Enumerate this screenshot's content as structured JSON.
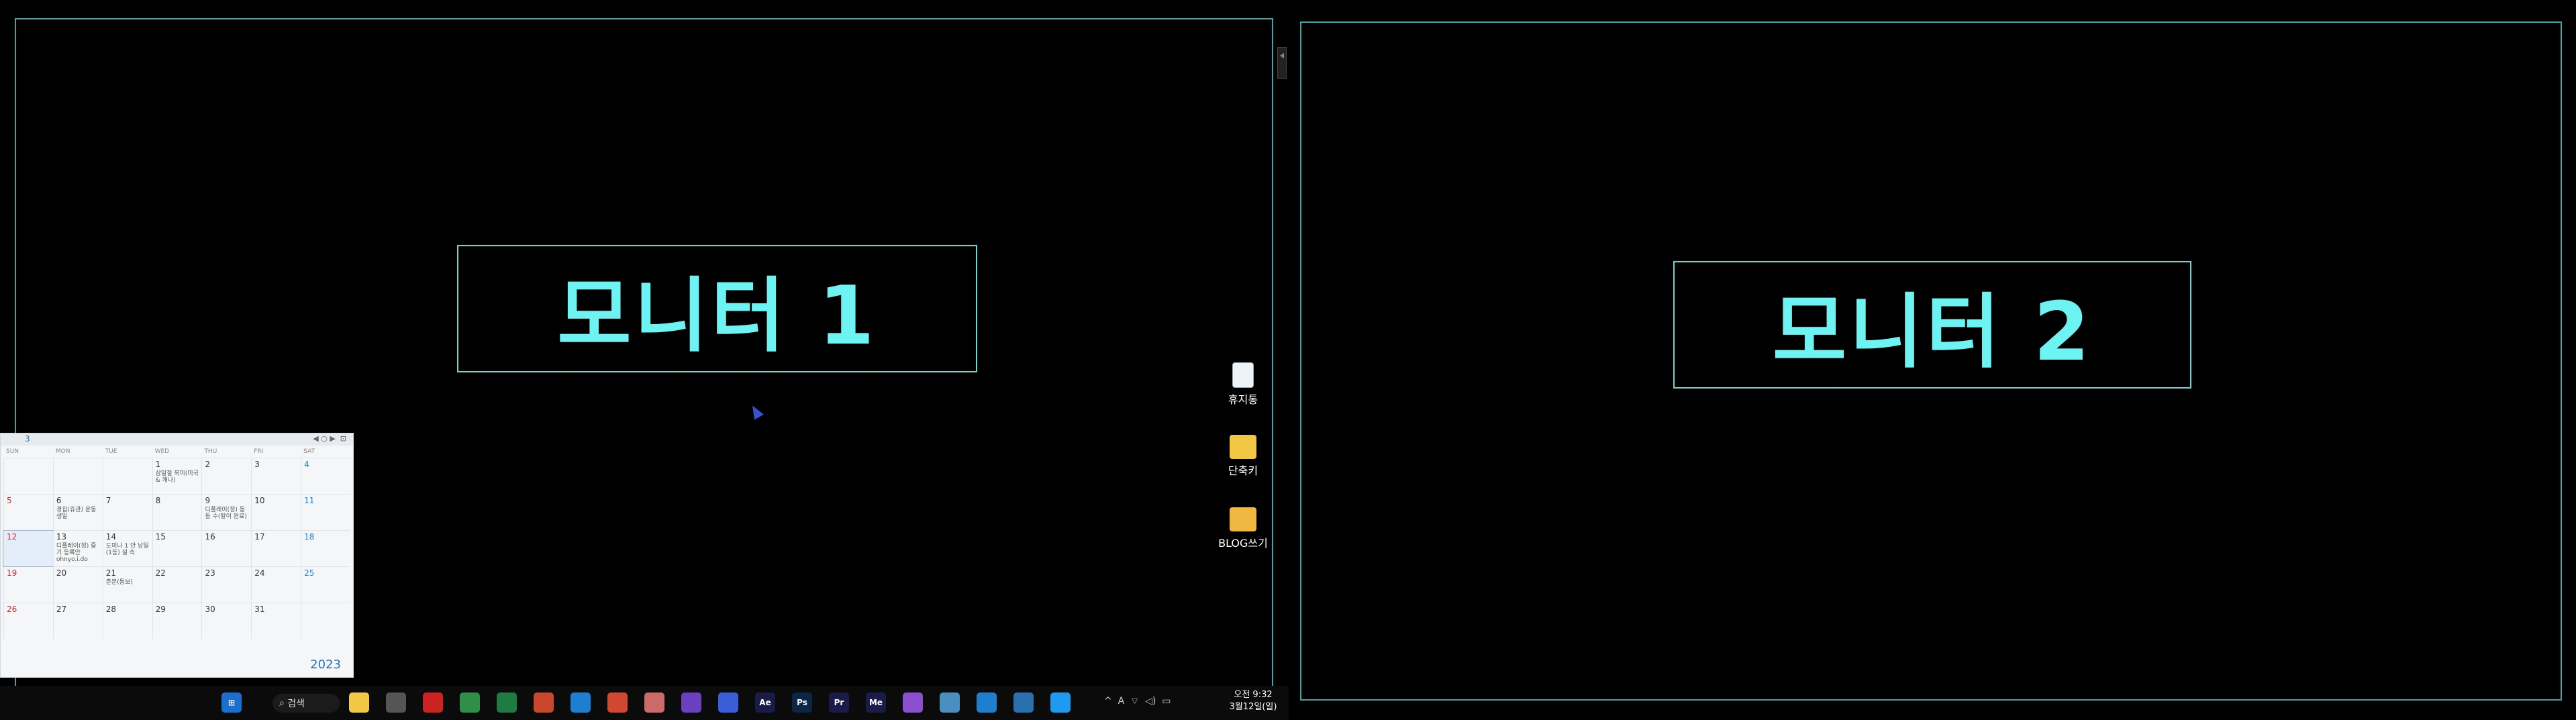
{
  "monitors": {
    "monitor1_label": "모니터 1",
    "monitor2_label": "모니터 2"
  },
  "desktop_icons": [
    {
      "label": "휴지통",
      "icon": "recycle-bin-icon"
    },
    {
      "label": "단축키",
      "icon": "folder-shortcut-icon"
    },
    {
      "label": "BLOG쓰기",
      "icon": "folder-shortcut-icon"
    }
  ],
  "calendar": {
    "month": "3",
    "year": "2023",
    "weekdays": [
      "SUN",
      "MON",
      "TUE",
      "WED",
      "THU",
      "FRI",
      "SAT"
    ],
    "weeks": [
      [
        {
          "day": "",
          "event": ""
        },
        {
          "day": "",
          "event": ""
        },
        {
          "day": "",
          "event": ""
        },
        {
          "day": "1",
          "event": "삼일절 북미(미국 & 캐나)"
        },
        {
          "day": "2",
          "event": ""
        },
        {
          "day": "3",
          "event": ""
        },
        {
          "day": "4",
          "event": ""
        }
      ],
      [
        {
          "day": "5",
          "event": ""
        },
        {
          "day": "6",
          "event": "경칩(휴관) 운동생일"
        },
        {
          "day": "7",
          "event": ""
        },
        {
          "day": "8",
          "event": ""
        },
        {
          "day": "9",
          "event": "디플레이(정) 동 동 수(탈이 완료)"
        },
        {
          "day": "10",
          "event": ""
        },
        {
          "day": "11",
          "event": ""
        }
      ],
      [
        {
          "day": "12",
          "event": ""
        },
        {
          "day": "13",
          "event": "디플레이(정) 중기 등록안 ohnyo.i.do"
        },
        {
          "day": "14",
          "event": "도미나 1 안 남일(1등) 설 속"
        },
        {
          "day": "15",
          "event": ""
        },
        {
          "day": "16",
          "event": ""
        },
        {
          "day": "17",
          "event": ""
        },
        {
          "day": "18",
          "event": ""
        }
      ],
      [
        {
          "day": "19",
          "event": ""
        },
        {
          "day": "20",
          "event": ""
        },
        {
          "day": "21",
          "event": "춘분(통보)"
        },
        {
          "day": "22",
          "event": ""
        },
        {
          "day": "23",
          "event": ""
        },
        {
          "day": "24",
          "event": ""
        },
        {
          "day": "25",
          "event": ""
        }
      ],
      [
        {
          "day": "26",
          "event": ""
        },
        {
          "day": "27",
          "event": ""
        },
        {
          "day": "28",
          "event": ""
        },
        {
          "day": "29",
          "event": ""
        },
        {
          "day": "30",
          "event": ""
        },
        {
          "day": "31",
          "event": ""
        },
        {
          "day": "",
          "event": ""
        }
      ]
    ]
  },
  "taskbar": {
    "search_label": "검색",
    "apps": [
      {
        "name": "file-explorer-icon",
        "label": "",
        "color": "#f2c744"
      },
      {
        "name": "usb-icon",
        "label": "",
        "color": "#555555"
      },
      {
        "name": "record-icon",
        "label": "",
        "color": "#cc2222"
      },
      {
        "name": "chrome-icon",
        "label": "",
        "color": "#2f8f46"
      },
      {
        "name": "excel-icon",
        "label": "",
        "color": "#1f7a43"
      },
      {
        "name": "powerpoint-icon",
        "label": "",
        "color": "#c9472a"
      },
      {
        "name": "calendar-app-icon",
        "label": "",
        "color": "#1e7fd0"
      },
      {
        "name": "network-icon",
        "label": "",
        "color": "#d2472f"
      },
      {
        "name": "notepad-icon",
        "label": "",
        "color": "#cc6a6a"
      },
      {
        "name": "visual-studio-icon",
        "label": "",
        "color": "#6a3fc0"
      },
      {
        "name": "chat-icon",
        "label": "",
        "color": "#3a5ed8"
      },
      {
        "name": "after-effects-icon",
        "label": "Ae",
        "color": "#1b1b4a"
      },
      {
        "name": "photoshop-icon",
        "label": "Ps",
        "color": "#0c2746"
      },
      {
        "name": "premiere-icon",
        "label": "Pr",
        "color": "#1b1b4a"
      },
      {
        "name": "media-encoder-icon",
        "label": "Me",
        "color": "#1b1b4a"
      },
      {
        "name": "screenshot-icon",
        "label": "",
        "color": "#8a4fd0"
      },
      {
        "name": "photo-icon",
        "label": "",
        "color": "#4a8fc0"
      },
      {
        "name": "edge-icon",
        "label": "",
        "color": "#1e7fd0"
      },
      {
        "name": "paint-icon",
        "label": "",
        "color": "#2a6fb0"
      },
      {
        "name": "twitter-icon",
        "label": "",
        "color": "#1d9bf0"
      }
    ],
    "clock_time": "오전 9:32",
    "clock_date": "3월12일(일)"
  }
}
